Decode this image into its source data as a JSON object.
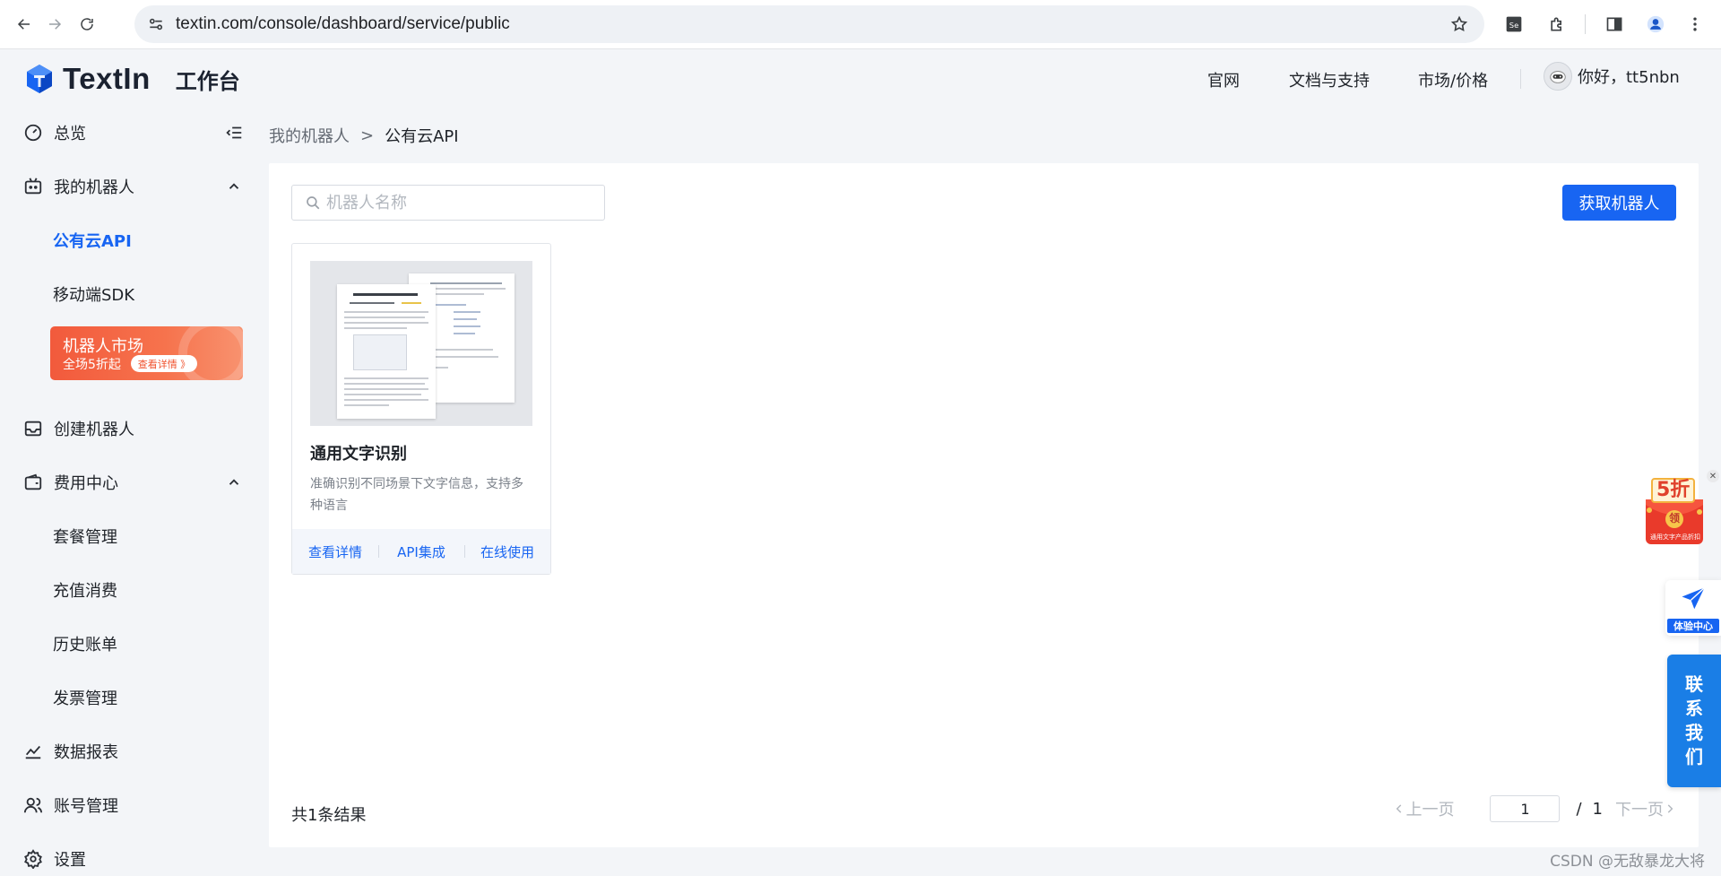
{
  "browser": {
    "url": "textin.com/console/dashboard/service/public"
  },
  "header": {
    "logo_text": "TextIn",
    "subtitle": "工作台",
    "nav": [
      "官网",
      "文档与支持",
      "市场/价格"
    ],
    "greeting": "你好，tt5nbn"
  },
  "sidebar": {
    "items": [
      {
        "label": "总览",
        "icon": "dashboard-icon"
      },
      {
        "label": "我的机器人",
        "icon": "robot-icon"
      },
      {
        "label": "创建机器人",
        "icon": "inbox-icon"
      },
      {
        "label": "费用中心",
        "icon": "wallet-icon"
      },
      {
        "label": "数据报表",
        "icon": "chart-icon"
      },
      {
        "label": "账号管理",
        "icon": "users-icon"
      },
      {
        "label": "设置",
        "icon": "gear-icon"
      }
    ],
    "robot_sub": [
      "公有云API",
      "移动端SDK"
    ],
    "fee_sub": [
      "套餐管理",
      "充值消费",
      "历史账单",
      "发票管理"
    ],
    "promo": {
      "title": "机器人市场",
      "subtitle": "全场5折起",
      "button": "查看详情 》"
    }
  },
  "breadcrumb": {
    "parent": "我的机器人",
    "separator": ">",
    "current": "公有云API"
  },
  "main": {
    "search_placeholder": "机器人名称",
    "get_robot_button": "获取机器人",
    "card": {
      "title": "通用文字识别",
      "description": "准确识别不同场景下文字信息，支持多种语言",
      "actions": [
        "查看详情",
        "API集成",
        "在线使用"
      ]
    },
    "total_text": "共1条结果",
    "pagination": {
      "prev": "上一页",
      "next": "下一页",
      "current": "1",
      "separator": "/",
      "total_pages": "1"
    }
  },
  "floating": {
    "discount": "5折",
    "discount_sub": "领",
    "discount_caption": "通用文字产品折扣",
    "experience_center": "体验中心",
    "contact": [
      "联",
      "系",
      "我",
      "们"
    ]
  },
  "watermark": "CSDN @无敌暴龙大将",
  "colors": {
    "accent": "#1865f2",
    "promo": "#f25a3c",
    "background": "#f3f5f8"
  }
}
